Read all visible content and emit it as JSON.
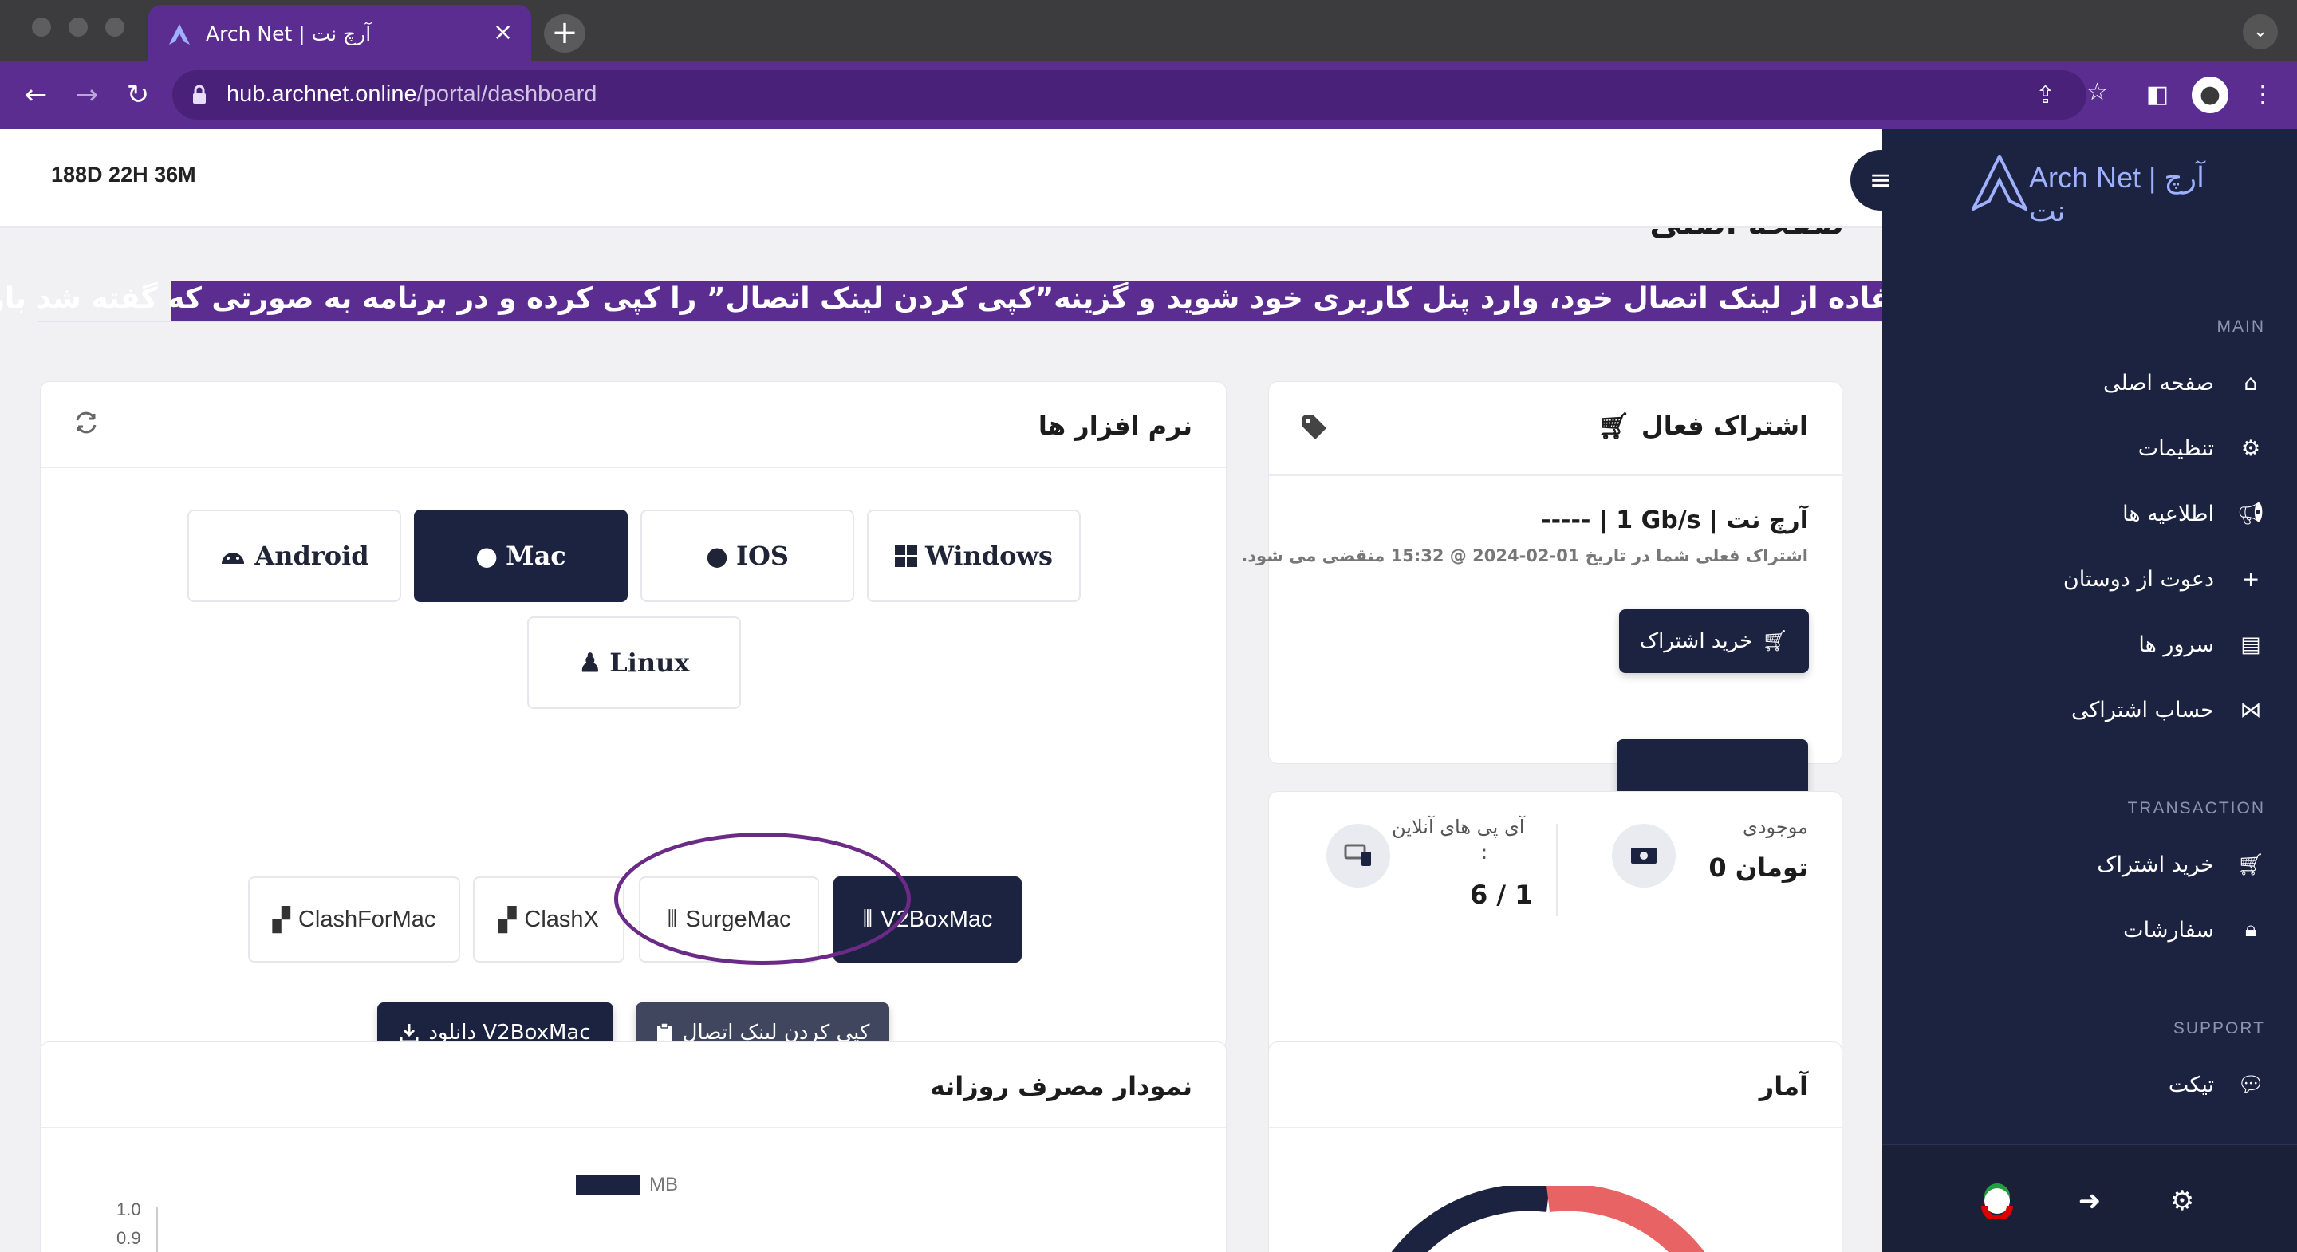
{
  "browser": {
    "tab_title": "Arch Net | آرچ نت",
    "url_host": "hub.archnet.online",
    "url_path": "/portal/dashboard"
  },
  "header": {
    "timer": "188D 22H 36M",
    "logo_text": "Arch Net | آرچ نت"
  },
  "page": {
    "title": "صفحه اصلی",
    "notice": "جهت استفاده از لینک اتصال خود، وارد پنل کاربری خود شوید و گزینه”کپی کردن لینک اتصال” را کپی کرده و در برنامه به صورتی که گفته شد بارگزاری کنید"
  },
  "sidebar": {
    "sections": {
      "main": "MAIN",
      "transaction": "TRANSACTION",
      "support": "SUPPORT"
    },
    "main_items": [
      {
        "label": "صفحه اصلی",
        "icon": "home-icon"
      },
      {
        "label": "تنظیمات",
        "icon": "user-gear-icon"
      },
      {
        "label": "اطلاعیه ها",
        "icon": "megaphone-icon"
      },
      {
        "label": "دعوت از دوستان",
        "icon": "user-plus-icon"
      },
      {
        "label": "سرور ها",
        "icon": "server-icon"
      },
      {
        "label": "حساب اشتراکی",
        "icon": "share-icon"
      }
    ],
    "transaction_items": [
      {
        "label": "خرید اشتراک",
        "icon": "cart-icon"
      },
      {
        "label": "سفارشات",
        "icon": "lock-icon"
      }
    ],
    "support_items": [
      {
        "label": "تیکت",
        "icon": "comments-icon"
      }
    ]
  },
  "software": {
    "title": "نرم افزار ها",
    "os": [
      "Android",
      "Mac",
      "IOS",
      "Windows",
      "Linux"
    ],
    "active_os": "Mac",
    "apps": [
      "ClashForMac",
      "ClashX",
      "SurgeMac",
      "V2BoxMac"
    ],
    "active_app": "V2BoxMac",
    "download_label": "دانلود V2BoxMac",
    "copy_label": "کپی کردن لینک اتصال"
  },
  "subscription": {
    "title": "اشتراک فعال",
    "plan": "----- | 1 Gb/s | آرچ نت",
    "expiry": "اشتراک فعلی شما در تاریخ 01-02-2024 @ 15:32 منقضی می شود.",
    "buy_label": "خرید اشتراک"
  },
  "balance": {
    "label": "موجودی",
    "value": "0 تومان",
    "online_label": "آی پی های آنلاین",
    "online_colon": ":",
    "online_value": "1 / 6"
  },
  "stats": {
    "title": "آمار"
  },
  "daily_usage": {
    "title": "نمودار مصرف روزانه",
    "legend": "MB",
    "yticks": [
      "1.0",
      "0.9"
    ]
  },
  "colors": {
    "brand_purple": "#5b2d91",
    "navy": "#1c2340",
    "donut_red": "#e86464"
  }
}
